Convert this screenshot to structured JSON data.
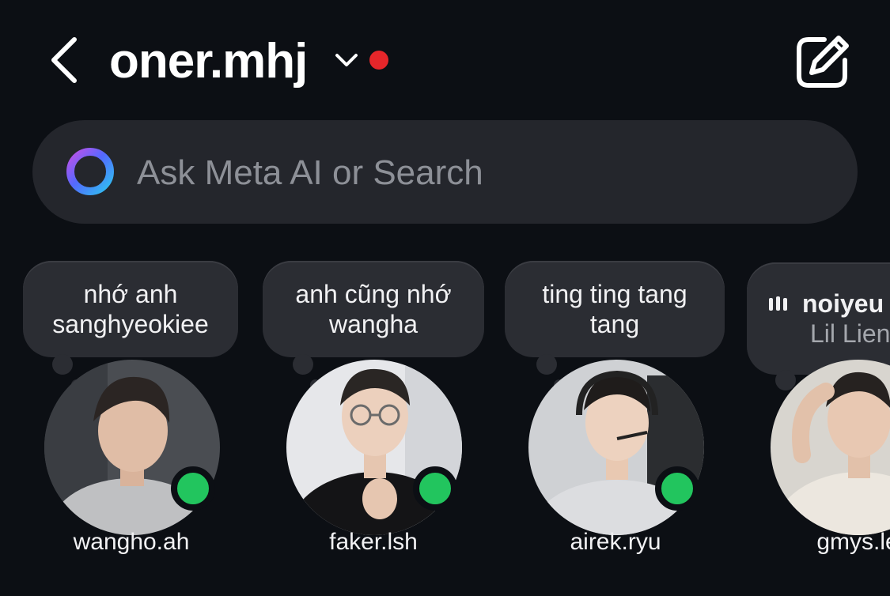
{
  "header": {
    "username": "oner.mhj",
    "unread_color": "#e5262a",
    "icons": [
      "chevron-left-icon",
      "chevron-down-icon",
      "compose-icon"
    ]
  },
  "search": {
    "placeholder": "Ask Meta AI or Search",
    "icon": "meta-ai-ring-icon"
  },
  "contacts": [
    {
      "name": "wangho.ah",
      "note_line1": "nhớ anh",
      "note_line2": "sanghyeokiee",
      "online": true
    },
    {
      "name": "faker.lsh",
      "note_line1": "anh cũng nhớ",
      "note_line2": "wangha",
      "online": true
    },
    {
      "name": "airek.ryu",
      "note_line1": "ting ting tang",
      "note_line2": "tang",
      "online": true
    },
    {
      "name": "gmys.le",
      "note_line1": "noiyeu",
      "note_line2": "Lil Lien",
      "online": false,
      "note_is_music": true
    }
  ],
  "colors": {
    "background": "#0c0f14",
    "search_bg": "#24262c",
    "note_bg": "#2b2d33",
    "online": "#22c55e"
  }
}
